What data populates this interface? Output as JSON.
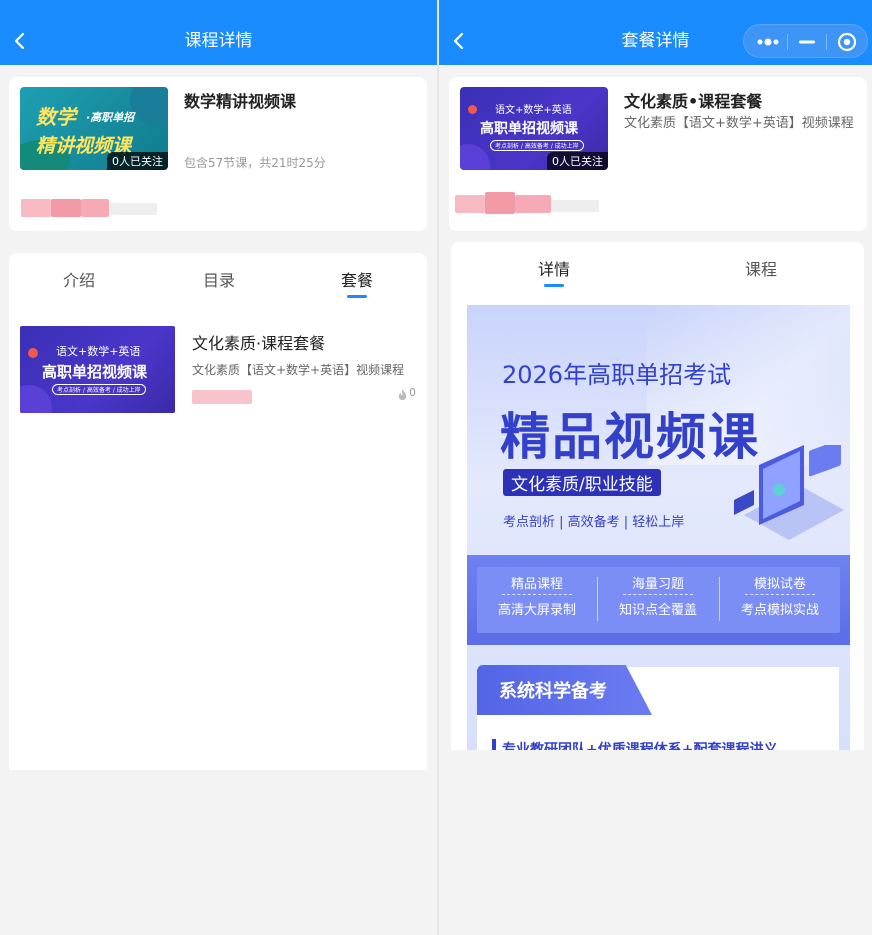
{
  "left": {
    "nav_title": "课程详情",
    "course": {
      "title": "数学精讲视频课",
      "thumb_line1": "数学",
      "thumb_line1b": "·高职单招",
      "thumb_line2": "精讲视频课",
      "follow": "0人已关注",
      "meta": "包含57节课，共21时25分"
    },
    "tabs": [
      {
        "label": "介绍"
      },
      {
        "label": "目录"
      },
      {
        "label": "套餐"
      }
    ],
    "package": {
      "title": "文化素质·课程套餐",
      "desc": "文化素质【语文+数学+英语】视频课程",
      "views": "0",
      "thumb_line1": "语文+数学+英语",
      "thumb_line2": "高职单招视频课",
      "thumb_line3": "考点剖析 / 高效备考 / 成功上岸"
    }
  },
  "right": {
    "nav_title": "套餐详情",
    "package": {
      "title": "文化素质•课程套餐",
      "desc": "文化素质【语文+数学+英语】视频课程",
      "follow": "0人已关注",
      "thumb_line1": "语文+数学+英语",
      "thumb_line2": "高职单招视频课",
      "thumb_line3": "考点剖析 / 高效备考 / 成功上岸"
    },
    "tabs": [
      {
        "label": "详情"
      },
      {
        "label": "课程"
      }
    ],
    "poster": {
      "line1": "2026年高职单招考试",
      "line2": "精品视频课",
      "badge": "文化素质/职业技能",
      "tagline": "考点剖析 | 高效备考 | 轻松上岸",
      "features": [
        {
          "title": "精品课程",
          "desc": "高清大屏录制"
        },
        {
          "title": "海量习题",
          "desc": "知识点全覆盖"
        },
        {
          "title": "模拟试卷",
          "desc": "考点模拟实战"
        }
      ],
      "section_title": "系统科学备考",
      "section_text": "专业教研团队+优质课程体系+配套课程讲义"
    }
  },
  "colors": {
    "nav_blue": "#1a8cfe",
    "poster_purple": "#3b2fc0",
    "accent_red": "#f04b4b"
  }
}
